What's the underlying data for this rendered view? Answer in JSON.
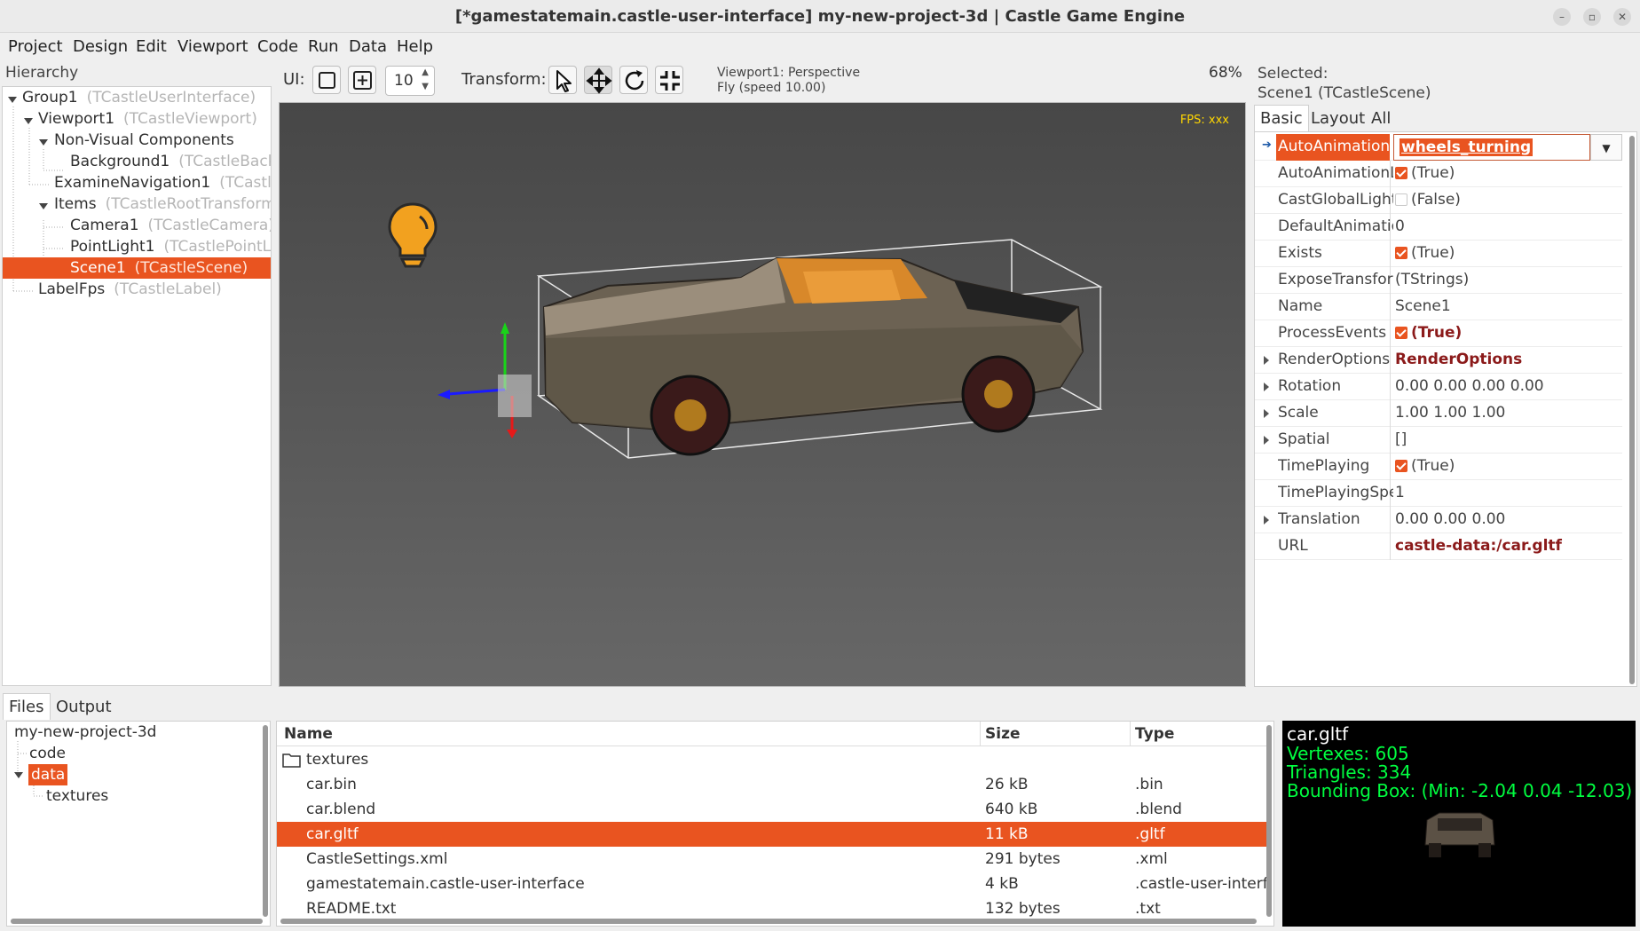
{
  "window": {
    "title": "[*gamestatemain.castle-user-interface] my-new-project-3d | Castle Game Engine"
  },
  "menu": [
    "Project",
    "Design",
    "Edit",
    "Viewport",
    "Code",
    "Run",
    "Data",
    "Help"
  ],
  "hierarchy": {
    "label": "Hierarchy",
    "items": [
      {
        "name": "Group1",
        "cls": "(TCastleUserInterface)"
      },
      {
        "name": "Viewport1",
        "cls": "(TCastleViewport)"
      },
      {
        "name": "Non-Visual Components",
        "cls": ""
      },
      {
        "name": "Background1",
        "cls": "(TCastleBackg"
      },
      {
        "name": "ExamineNavigation1",
        "cls": "(TCastleE"
      },
      {
        "name": "Items",
        "cls": "(TCastleRootTransform"
      },
      {
        "name": "Camera1",
        "cls": "(TCastleCamera)"
      },
      {
        "name": "PointLight1",
        "cls": "(TCastlePointLi"
      },
      {
        "name": "Scene1",
        "cls": "(TCastleScene)"
      },
      {
        "name": "LabelFps",
        "cls": "(TCastleLabel)"
      }
    ]
  },
  "toolbar": {
    "ui_label": "UI:",
    "spin_value": "10",
    "transform_label": "Transform:",
    "viewport_info_line1": "Viewport1: Perspective",
    "viewport_info_line2": "Fly (speed 10.00)",
    "zoom": "68%"
  },
  "viewport": {
    "fps_text": "FPS: xxx"
  },
  "inspector": {
    "selected_line1": "Selected:",
    "selected_line2": "Scene1 (TCastleScene)",
    "tabs": [
      "Basic",
      "Layout",
      "All"
    ],
    "properties": [
      {
        "name": "AutoAnimation",
        "value": "wheels_turning"
      },
      {
        "name": "AutoAnimationL",
        "value": "(True)"
      },
      {
        "name": "CastGlobalLight",
        "value": "(False)"
      },
      {
        "name": "DefaultAnimatio",
        "value": "0"
      },
      {
        "name": "Exists",
        "value": "(True)"
      },
      {
        "name": "ExposeTransfor",
        "value": "(TStrings)"
      },
      {
        "name": "Name",
        "value": "Scene1"
      },
      {
        "name": "ProcessEvents",
        "value": "(True)"
      },
      {
        "name": "RenderOptions",
        "value": "RenderOptions"
      },
      {
        "name": "Rotation",
        "value": "0.00 0.00 0.00 0.00"
      },
      {
        "name": "Scale",
        "value": "1.00 1.00 1.00"
      },
      {
        "name": "Spatial",
        "value": "[]"
      },
      {
        "name": "TimePlaying",
        "value": "(True)"
      },
      {
        "name": "TimePlayingSpe",
        "value": "1"
      },
      {
        "name": "Translation",
        "value": "0.00 0.00 0.00"
      },
      {
        "name": "URL",
        "value": "castle-data:/car.gltf"
      }
    ]
  },
  "bottom": {
    "tabs": [
      "Files",
      "Output"
    ],
    "dirtree": [
      "my-new-project-3d",
      "code",
      "data",
      "textures"
    ],
    "columns": {
      "name": "Name",
      "size": "Size",
      "type": "Type"
    },
    "files": [
      {
        "name": "textures",
        "size": "",
        "type": ""
      },
      {
        "name": "car.bin",
        "size": "26 kB",
        "type": ".bin"
      },
      {
        "name": "car.blend",
        "size": "640 kB",
        "type": ".blend"
      },
      {
        "name": "car.gltf",
        "size": "11 kB",
        "type": ".gltf"
      },
      {
        "name": "CastleSettings.xml",
        "size": "291 bytes",
        "type": ".xml"
      },
      {
        "name": "gamestatemain.castle-user-interface",
        "size": "4 kB",
        "type": ".castle-user-interfa"
      },
      {
        "name": "README.txt",
        "size": "132 bytes",
        "type": ".txt"
      }
    ],
    "preview": {
      "title": "car.gltf",
      "vertexes": "Vertexes: 605",
      "triangles": "Triangles: 334",
      "bbox": "Bounding Box: (Min: -2.04 0.04 -12.03)"
    }
  },
  "colors": {
    "accent": "#e95420",
    "fps": "#ffd700",
    "preview_green": "#00ff40"
  }
}
